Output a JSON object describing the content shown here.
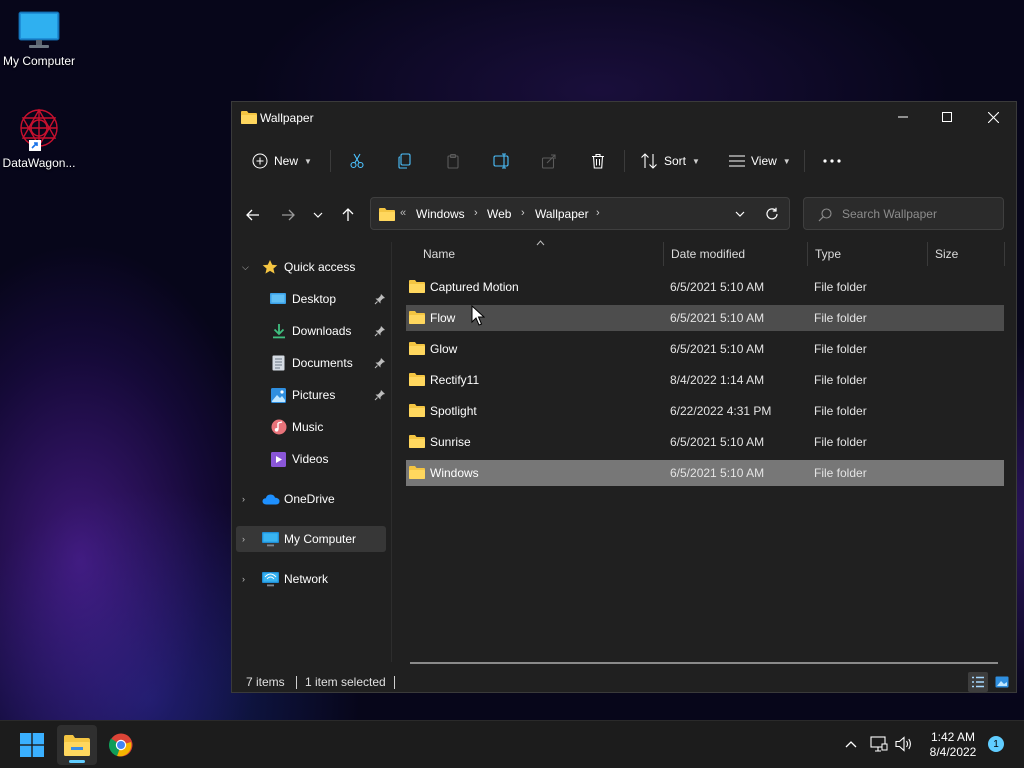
{
  "desktop": {
    "icons": [
      {
        "label": "My Computer",
        "icon": "monitor-icon"
      },
      {
        "label": "DataWagon...",
        "icon": "datawagon-shortcut-icon"
      }
    ]
  },
  "window": {
    "title": "Wallpaper",
    "toolbar": {
      "new_label": "New",
      "sort_label": "Sort",
      "view_label": "View"
    },
    "address": {
      "overflow": "«",
      "crumbs": [
        "Windows",
        "Web",
        "Wallpaper"
      ]
    },
    "search": {
      "placeholder": "Search Wallpaper"
    },
    "nav": {
      "quick_access": "Quick access",
      "quick_items": [
        "Desktop",
        "Downloads",
        "Documents",
        "Pictures",
        "Music",
        "Videos"
      ],
      "onedrive": "OneDrive",
      "my_computer": "My Computer",
      "network": "Network"
    },
    "columns": {
      "name": "Name",
      "date": "Date modified",
      "type": "Type",
      "size": "Size"
    },
    "files": [
      {
        "name": "Captured Motion",
        "date": "6/5/2021 5:10 AM",
        "type": "File folder"
      },
      {
        "name": "Flow",
        "date": "6/5/2021 5:10 AM",
        "type": "File folder"
      },
      {
        "name": "Glow",
        "date": "6/5/2021 5:10 AM",
        "type": "File folder"
      },
      {
        "name": "Rectify11",
        "date": "8/4/2022 1:14 AM",
        "type": "File folder"
      },
      {
        "name": "Spotlight",
        "date": "6/22/2022 4:31 PM",
        "type": "File folder"
      },
      {
        "name": "Sunrise",
        "date": "6/5/2021 5:10 AM",
        "type": "File folder"
      },
      {
        "name": "Windows",
        "date": "6/5/2021 5:10 AM",
        "type": "File folder"
      }
    ],
    "status": {
      "count": "7 items",
      "selected": "1 item selected"
    }
  },
  "taskbar": {
    "time": "1:42 AM",
    "date": "8/4/2022",
    "notifications": "1"
  },
  "colors": {
    "accent": "#60cdff",
    "folder": "#f4c542",
    "window_bg": "#202020"
  }
}
